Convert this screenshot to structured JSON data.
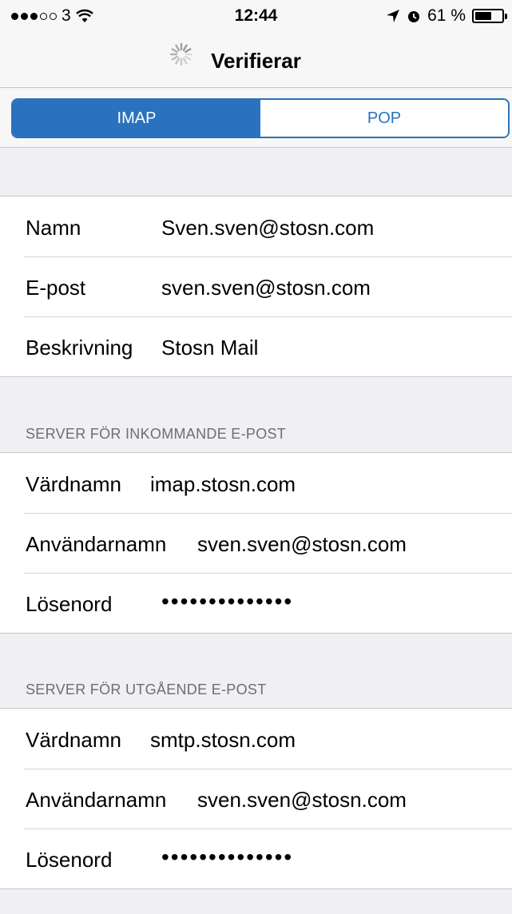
{
  "status_bar": {
    "carrier": "3",
    "time": "12:44",
    "battery_percent": "61 %",
    "battery_level": 0.61,
    "icons": [
      "signal-dots",
      "wifi-icon",
      "location-arrow-icon",
      "alarm-clock-icon",
      "battery-icon"
    ]
  },
  "nav": {
    "title": "Verifierar",
    "icon": "activity-spinner-icon"
  },
  "segmented": {
    "options": [
      "IMAP",
      "POP"
    ],
    "selected": "IMAP",
    "accent": "#2b72be"
  },
  "account": {
    "rows": [
      {
        "label": "Namn",
        "value": "Sven.sven@stosn.com"
      },
      {
        "label": "E-post",
        "value": "sven.sven@stosn.com"
      },
      {
        "label": "Beskrivning",
        "value": "Stosn Mail"
      }
    ]
  },
  "incoming": {
    "header": "SERVER FÖR INKOMMANDE E-POST",
    "rows": [
      {
        "label": "Värdnamn",
        "value": "imap.stosn.com"
      },
      {
        "label": "Användarnamn",
        "value": "sven.sven@stosn.com"
      },
      {
        "label": "Lösenord",
        "value": "••••••••••••••"
      }
    ]
  },
  "outgoing": {
    "header": "SERVER FÖR UTGÅENDE E-POST",
    "rows": [
      {
        "label": "Värdnamn",
        "value": "smtp.stosn.com"
      },
      {
        "label": "Användarnamn",
        "value": "sven.sven@stosn.com"
      },
      {
        "label": "Lösenord",
        "value": "••••••••••••••"
      }
    ]
  }
}
